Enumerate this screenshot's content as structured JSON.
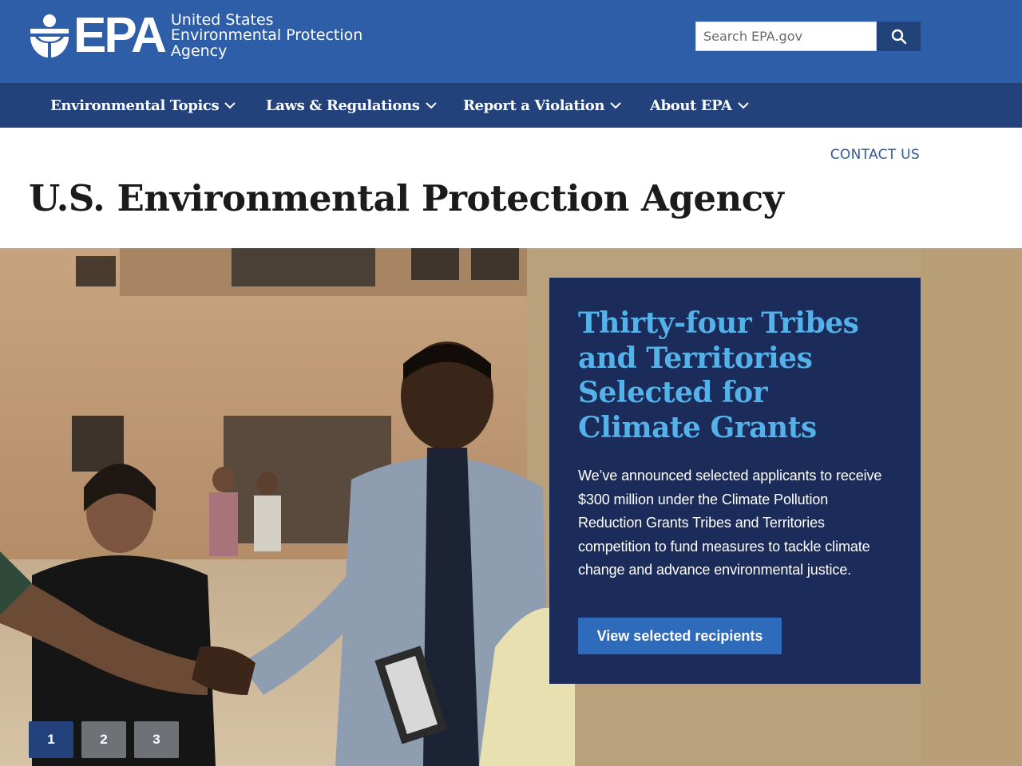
{
  "header": {
    "logo_text": "EPA",
    "agency_lines": [
      "United States",
      "Environmental Protection",
      "Agency"
    ],
    "search_placeholder": "Search EPA.gov",
    "search_icon": "search-icon",
    "colors": {
      "topbar": "#2e5ea8",
      "nav": "#23427c"
    }
  },
  "nav": {
    "items": [
      {
        "label": "Environmental Topics"
      },
      {
        "label": "Laws & Regulations"
      },
      {
        "label": "Report a Violation"
      },
      {
        "label": "About EPA"
      }
    ]
  },
  "contact_label": "CONTACT US",
  "page_title": "U.S. Environmental Protection Agency",
  "hero": {
    "heading": "Thirty-four Tribes and Territories Selected for Climate Grants",
    "body": "We’ve announced selected applicants to receive $300 million under the Climate Pollution Reduction Grants Tribes and Territories competition to fund measures to tackle climate change and advance environmental justice.",
    "button_label": "View selected recipients",
    "colors": {
      "card": "#1c2c5a",
      "heading": "#52b2e9",
      "button": "#2f6bbb"
    },
    "pager": [
      {
        "label": "1",
        "active": true
      },
      {
        "label": "2",
        "active": false
      },
      {
        "label": "3",
        "active": false
      }
    ]
  }
}
